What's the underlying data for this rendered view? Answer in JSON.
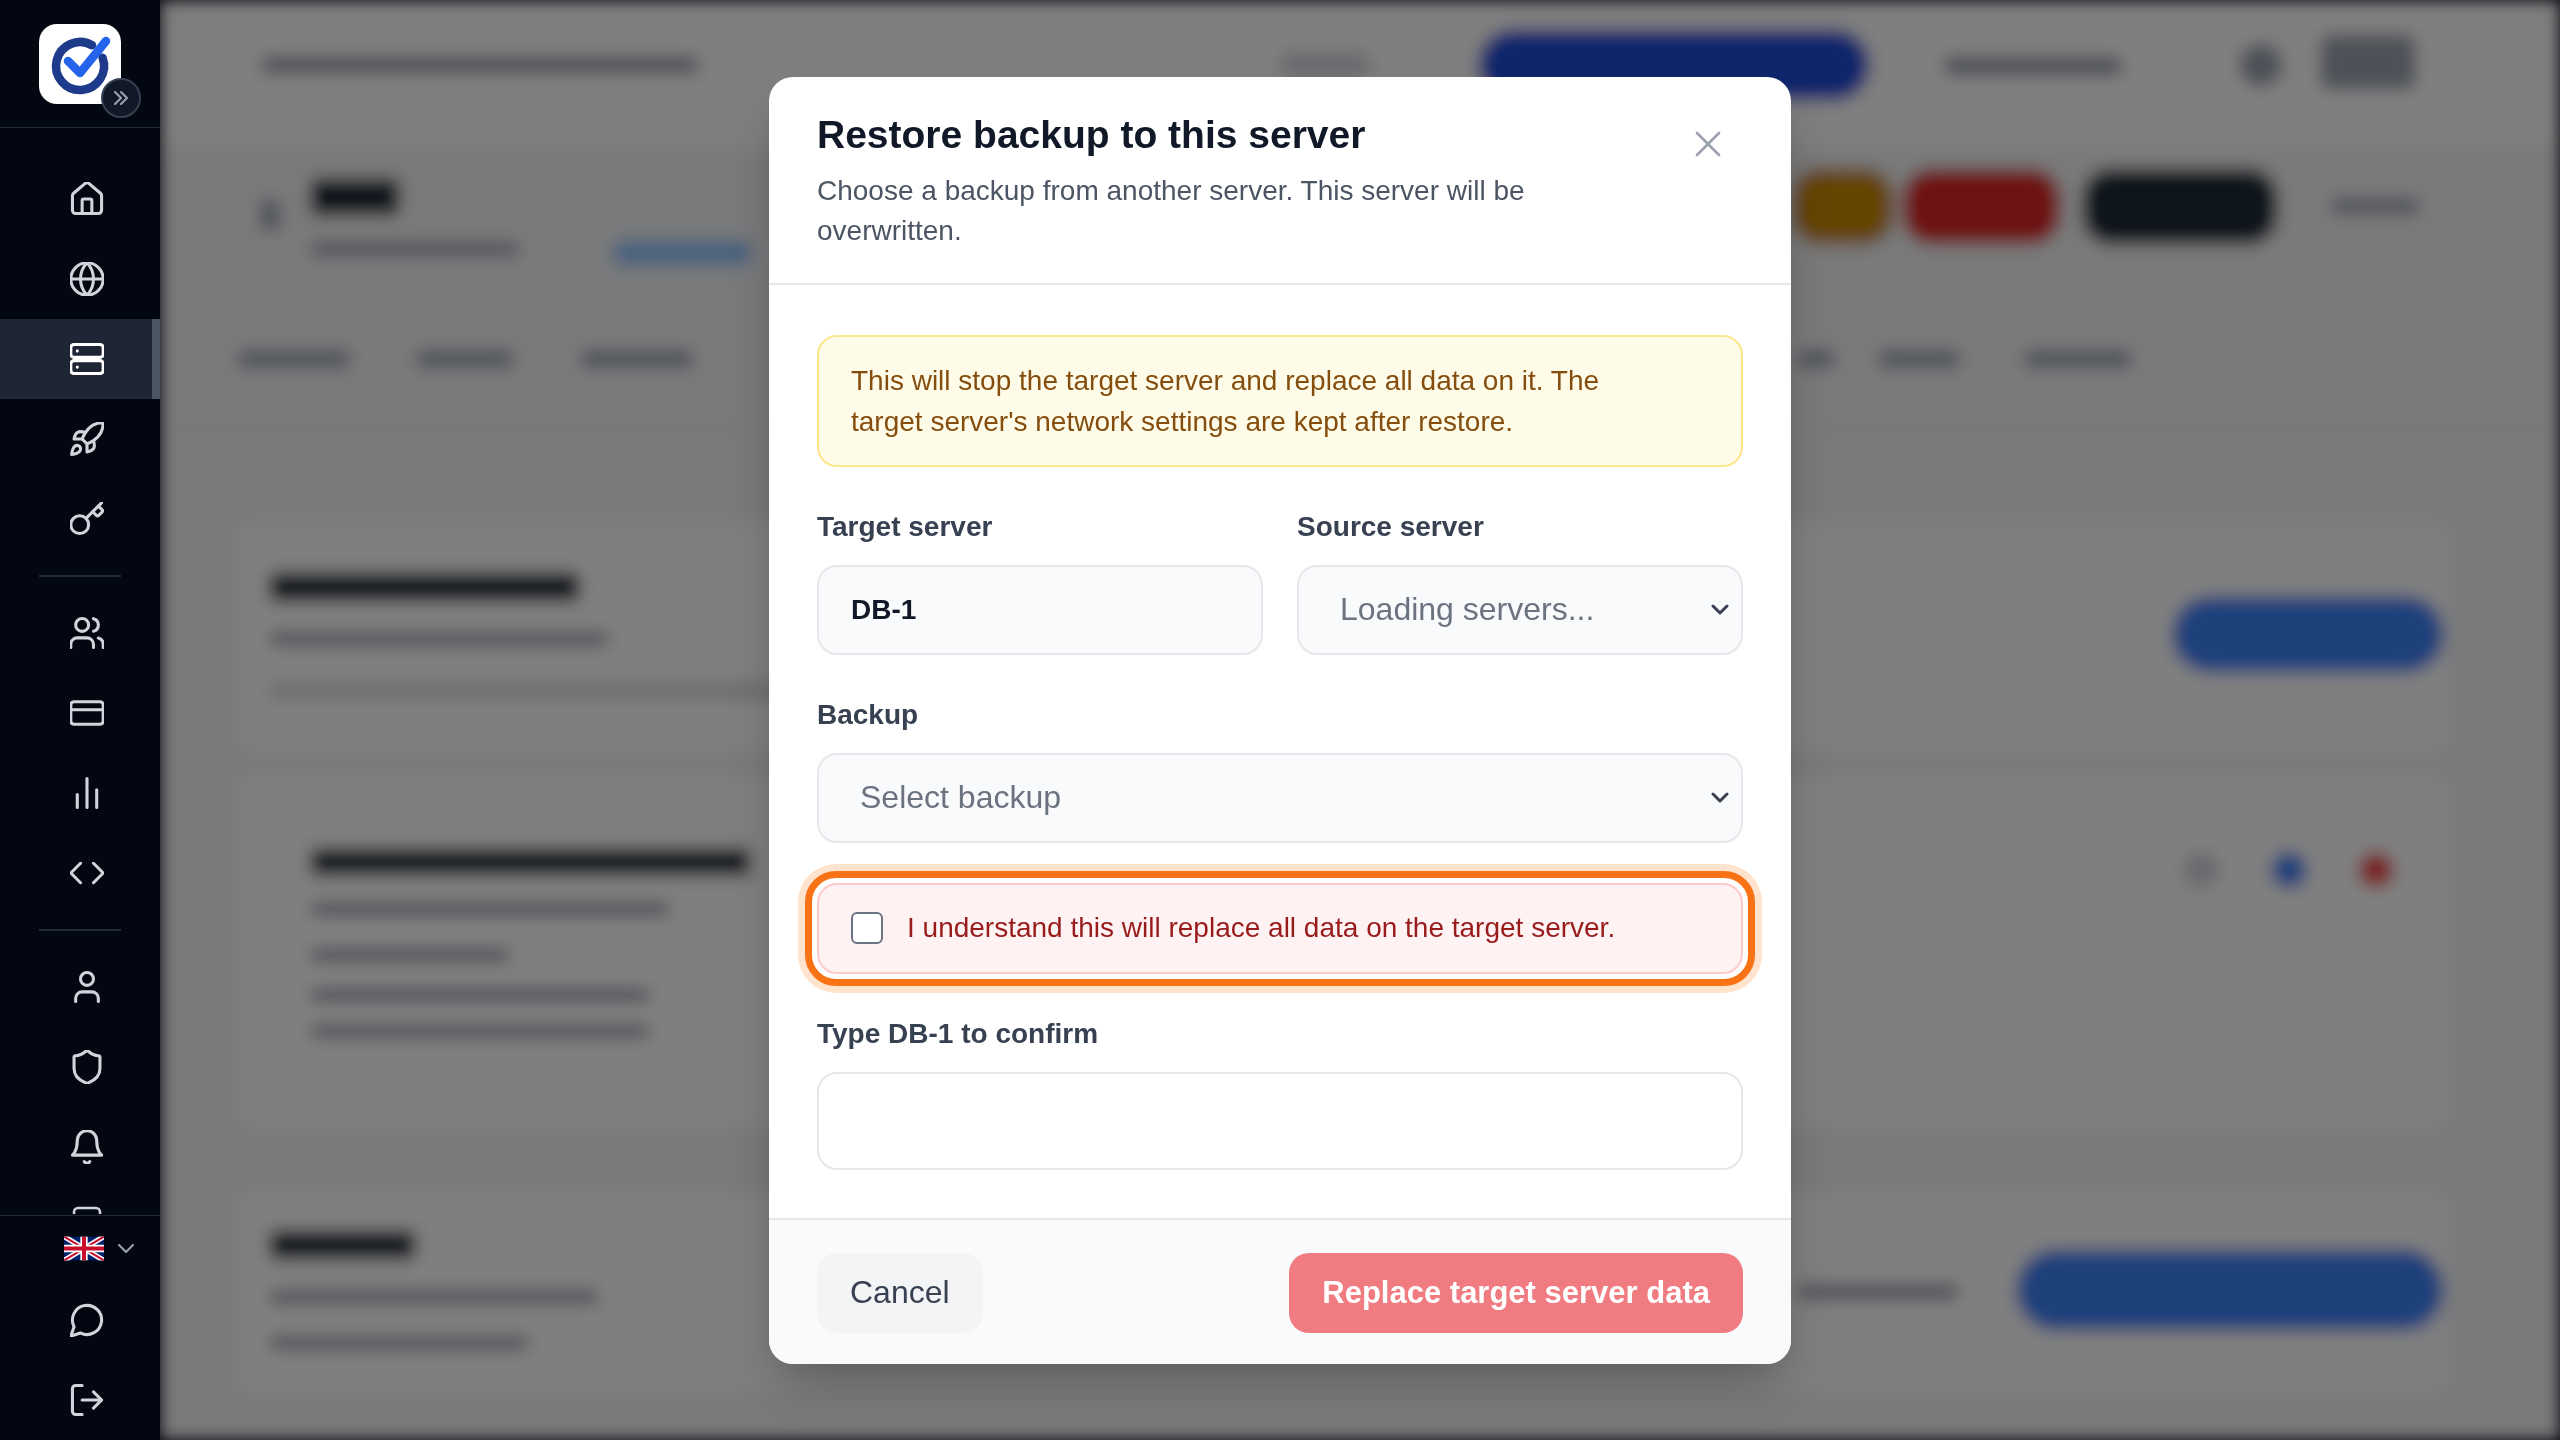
{
  "sidebar": {
    "nav_groups": [
      {
        "items": [
          {
            "kind": "home",
            "selected": false
          },
          {
            "kind": "globe",
            "selected": false
          },
          {
            "kind": "server",
            "selected": true
          },
          {
            "kind": "rocket",
            "selected": false
          },
          {
            "kind": "key",
            "selected": false
          }
        ]
      },
      {
        "items": [
          {
            "kind": "users",
            "selected": false
          },
          {
            "kind": "card",
            "selected": false
          },
          {
            "kind": "chart",
            "selected": false
          },
          {
            "kind": "code",
            "selected": false
          }
        ]
      },
      {
        "items": [
          {
            "kind": "user",
            "selected": false
          },
          {
            "kind": "shield",
            "selected": false
          },
          {
            "kind": "bell",
            "selected": false
          }
        ]
      }
    ],
    "footer_items": [
      {
        "kind": "language"
      },
      {
        "kind": "chat"
      },
      {
        "kind": "logout"
      }
    ]
  },
  "dialog": {
    "title": "Restore backup to this server",
    "description": "Choose a backup from another server. This server will be overwritten.",
    "warning": "This will stop the target server and replace all data on it. The target server's network settings are kept after restore.",
    "server_fields": [
      {
        "kind": "input",
        "label": "Target server",
        "value": "DB-1",
        "readonly": true
      },
      {
        "kind": "select",
        "label": "Source server",
        "placeholder": "Loading servers..."
      }
    ],
    "backup_field": {
      "kind": "select",
      "label": "Backup",
      "placeholder": "Select backup"
    },
    "confirm_checkbox": {
      "label": "I understand this will replace all data on the target server.",
      "checked": false,
      "focused": true
    },
    "confirm_field": {
      "kind": "input",
      "label": "Type DB-1 to confirm",
      "readonly": false
    },
    "buttons": [
      {
        "kind": "secondary",
        "label": "Cancel",
        "disabled": false
      },
      {
        "kind": "danger",
        "label": "Replace target server data",
        "disabled": true
      }
    ]
  }
}
